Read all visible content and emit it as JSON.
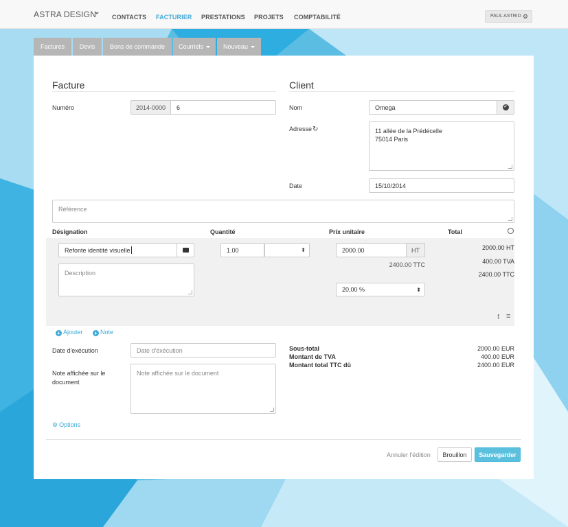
{
  "navbar": {
    "brand": "ASTRA DESIGN",
    "items": [
      {
        "label": "CONTACTS",
        "active": false
      },
      {
        "label": "FACTURIER",
        "active": true
      },
      {
        "label": "PRESTATIONS",
        "active": false
      },
      {
        "label": "PROJETS",
        "active": false
      },
      {
        "label": "COMPTABILITÉ",
        "active": false
      }
    ],
    "user": "PAUL ASTRID"
  },
  "tabs": [
    "Factures",
    "Devis",
    "Bons de commande",
    "Courriels",
    "Nouveau"
  ],
  "invoice": {
    "title": "Facture",
    "numero_label": "Numéro",
    "numero_prefix": "2014-0000",
    "numero_value": "6"
  },
  "client": {
    "title": "Client",
    "nom_label": "Nom",
    "nom_value": "Omega",
    "adresse_label": "Adresse",
    "adresse_line1": "11 allée de la Prédécelle",
    "adresse_line2": "75014 Paris",
    "date_label": "Date",
    "date_value": "15/10/2014"
  },
  "reference_placeholder": "Référence",
  "lines_header": {
    "designation": "Désignation",
    "quantite": "Quantité",
    "prix": "Prix unitaire",
    "total": "Total"
  },
  "line": {
    "designation": "Refonte identité visuelle",
    "description_placeholder": "Description",
    "quantite": "1.00",
    "prix": "2000.00",
    "prix_suffix": "HT",
    "ttc": "2400.00 TTC",
    "tva_rate": "20,00 %",
    "total_ht": "2000.00 HT",
    "total_tva": "400.00 TVA",
    "total_ttc": "2400.00 TTC"
  },
  "actions": {
    "ajouter": "Ajouter",
    "note": "Note",
    "options": "Options"
  },
  "execution": {
    "label": "Date d'exécution",
    "placeholder": "Date d'éxécution"
  },
  "note_doc": {
    "label_line1": "Note affichée sur le",
    "label_line2": "document",
    "placeholder": "Note affichée sur le document"
  },
  "totals": {
    "sous_total_label": "Sous-total",
    "tva_label": "Montant de TVA",
    "ttc_label": "Montant total TTC dû",
    "sous_total": "2000.00 EUR",
    "tva": "400.00 EUR",
    "ttc": "2400.00 EUR"
  },
  "footer": {
    "annuler": "Annuler l'édition",
    "brouillon": "Brouillon",
    "sauvegarder": "Sauvegarder"
  },
  "colors": {
    "accent": "#3fa9d6",
    "save_button": "#5bc0de"
  }
}
